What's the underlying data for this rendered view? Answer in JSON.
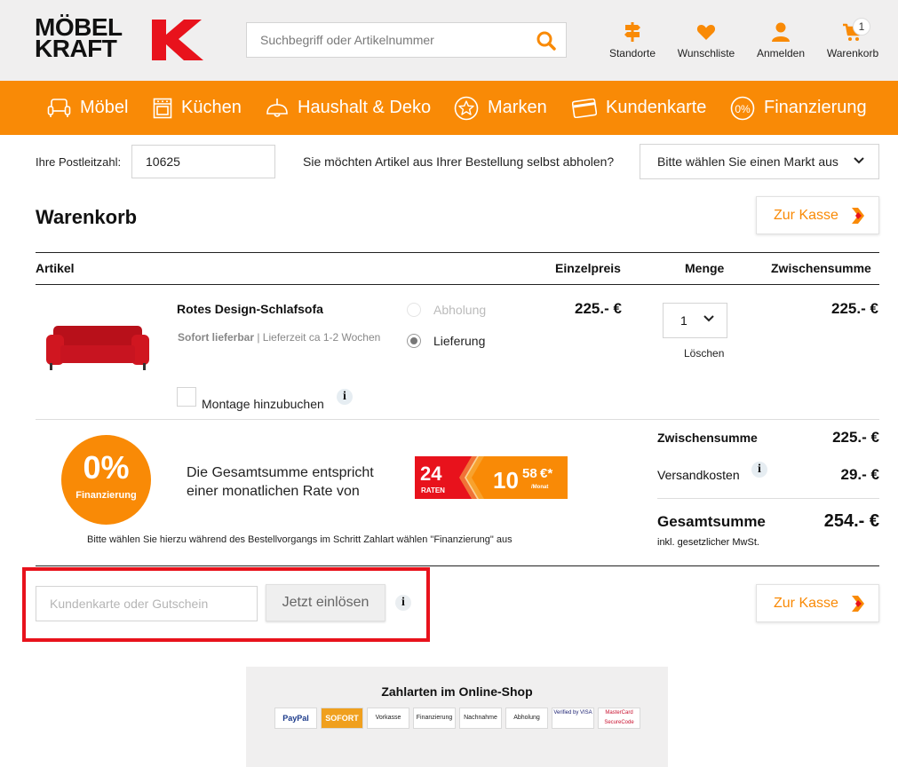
{
  "brand": {
    "line1": "MÖBEL",
    "line2": "KRAFT",
    "logo_mark": "K"
  },
  "search": {
    "placeholder": "Suchbegriff oder Artikelnummer"
  },
  "header_nav": [
    {
      "label": "Standorte",
      "icon": "signpost-icon"
    },
    {
      "label": "Wunschliste",
      "icon": "heart-icon"
    },
    {
      "label": "Anmelden",
      "icon": "user-icon"
    },
    {
      "label": "Warenkorb",
      "icon": "cart-icon",
      "badge": "1"
    }
  ],
  "main_nav": [
    {
      "label": "Möbel",
      "icon": "armchair-icon"
    },
    {
      "label": "Küchen",
      "icon": "stove-icon"
    },
    {
      "label": "Haushalt & Deko",
      "icon": "lamp-icon"
    },
    {
      "label": "Marken",
      "icon": "star-icon"
    },
    {
      "label": "Kundenkarte",
      "icon": "card-icon"
    },
    {
      "label": "Finanzierung",
      "icon": "percent-icon"
    }
  ],
  "postal": {
    "label": "Ihre Postleitzahl:",
    "value": "10625"
  },
  "pickup": {
    "question": "Sie möchten Artikel aus Ihrer Bestellung selbst abholen?",
    "select_value": "Bitte wählen Sie einen Markt aus"
  },
  "cart": {
    "title": "Warenkorb",
    "checkout_label": "Zur Kasse",
    "columns": {
      "article": "Artikel",
      "unit_price": "Einzelpreis",
      "quantity": "Menge",
      "subtotal": "Zwischensumme"
    },
    "item": {
      "name": "Rotes Design-Schlafsofa",
      "availability_bold": "Sofort lieferbar",
      "availability_rest": " | Lieferzeit ca 1-2 Wochen",
      "option_pickup": "Abholung",
      "option_delivery": "Lieferung",
      "unit_price": "225.- €",
      "quantity": "1",
      "delete_label": "Löschen",
      "subtotal": "225.- €",
      "montage_label": "Montage hinzubuchen",
      "info": "i"
    }
  },
  "financing": {
    "badge_pct": "0%",
    "badge_word": "Finanzierung",
    "text": "Die Gesamtsumme entspricht einer monatlichen Rate von",
    "rates_count": "24",
    "rates_word": "RATEN",
    "rate_amount": "10",
    "rate_cents": "58",
    "rate_currency": "€*",
    "rate_period": "/Monat",
    "note": "Bitte wählen Sie hierzu während des Bestellvorgangs im Schritt Zahlart wählen \"Finanzierung\" aus"
  },
  "totals": {
    "subtotal_label": "Zwischensumme",
    "subtotal_value": "225.- €",
    "shipping_label": "Versandkosten",
    "shipping_value": "29.- €",
    "total_label": "Gesamtsumme",
    "total_value": "254.- €",
    "vat_note": "inkl. gesetzlicher MwSt."
  },
  "voucher": {
    "placeholder": "Kundenkarte oder Gutschein",
    "button": "Jetzt einlösen",
    "info": "i"
  },
  "payment": {
    "title": "Zahlarten im Online-Shop",
    "methods": [
      "PayPal",
      "SOFORT",
      "Vorkasse",
      "Finanzierung",
      "Nachnahme",
      "Abholung",
      "Verified by VISA",
      "MasterCard SecureCode"
    ]
  },
  "colors": {
    "accent": "#f98a06",
    "brand_red": "#e8121c",
    "header_bg": "#f0efef"
  }
}
